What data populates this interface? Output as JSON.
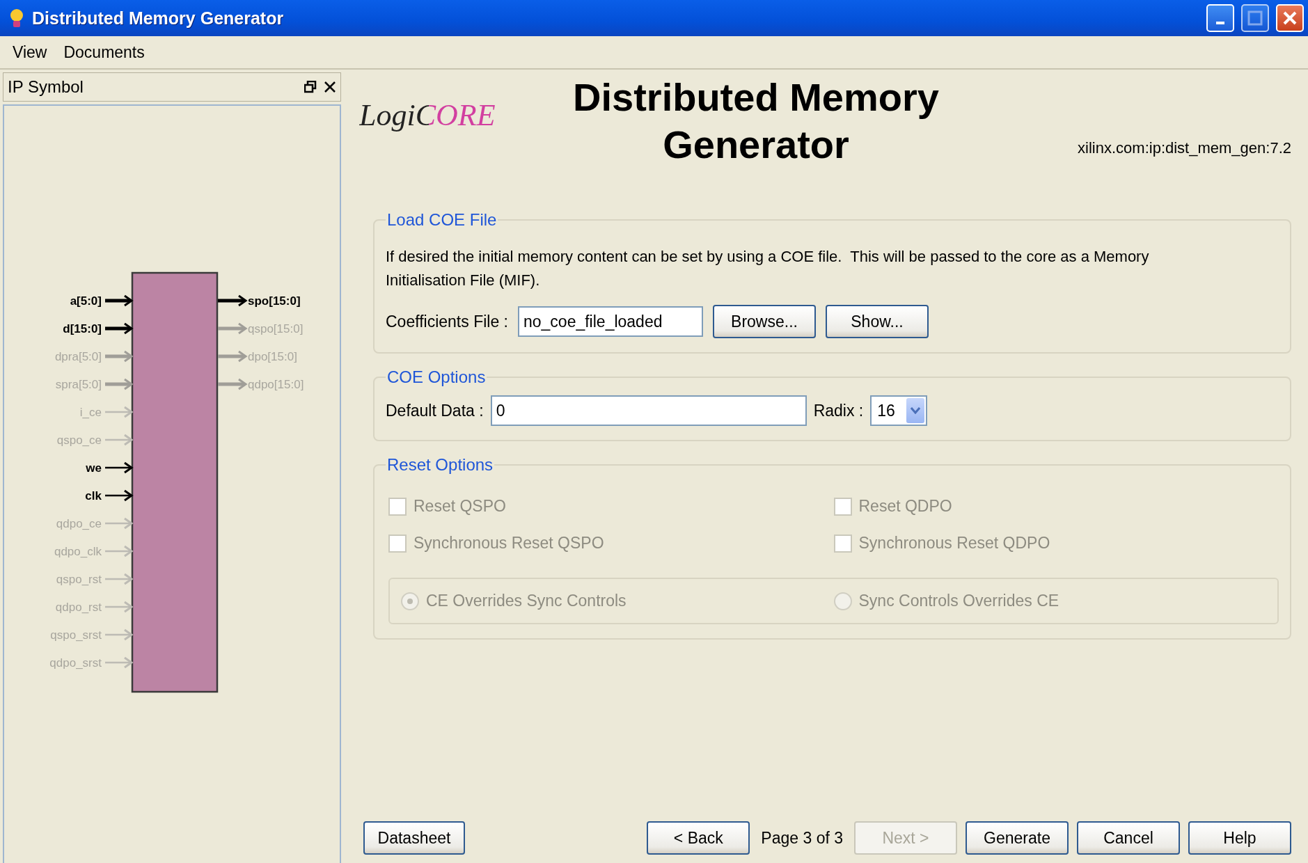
{
  "window": {
    "title": "Distributed Memory Generator"
  },
  "menu": [
    {
      "label": "View"
    },
    {
      "label": "Documents"
    }
  ],
  "ip_symbol": {
    "title": "IP Symbol",
    "inputs": [
      {
        "label": "a[5:0]",
        "active": true,
        "bus": true
      },
      {
        "label": "d[15:0]",
        "active": true,
        "bus": true
      },
      {
        "label": "dpra[5:0]",
        "active": false,
        "bus": true
      },
      {
        "label": "spra[5:0]",
        "active": false,
        "bus": true
      },
      {
        "label": "i_ce",
        "active": false,
        "bus": false
      },
      {
        "label": "qspo_ce",
        "active": false,
        "bus": false
      },
      {
        "label": "we",
        "active": true,
        "bus": false
      },
      {
        "label": "clk",
        "active": true,
        "bus": false
      },
      {
        "label": "qdpo_ce",
        "active": false,
        "bus": false
      },
      {
        "label": "qdpo_clk",
        "active": false,
        "bus": false
      },
      {
        "label": "qspo_rst",
        "active": false,
        "bus": false
      },
      {
        "label": "qdpo_rst",
        "active": false,
        "bus": false
      },
      {
        "label": "qspo_srst",
        "active": false,
        "bus": false
      },
      {
        "label": "qdpo_srst",
        "active": false,
        "bus": false
      }
    ],
    "outputs": [
      {
        "label": "spo[15:0]",
        "active": true,
        "bus": true
      },
      {
        "label": "qspo[15:0]",
        "active": false,
        "bus": true
      },
      {
        "label": "dpo[15:0]",
        "active": false,
        "bus": true
      },
      {
        "label": "qdpo[15:0]",
        "active": false,
        "bus": true
      }
    ]
  },
  "header": {
    "logo": "LogiCORE",
    "title": "Distributed Memory Generator",
    "version": "xilinx.com:ip:dist_mem_gen:7.2"
  },
  "load_coe": {
    "legend": "Load COE File",
    "description": "If desired the initial memory content can be set by using a COE file.  This will be passed to the core as a Memory Initialisation File (MIF).",
    "field_label": "Coefficients File :",
    "value": "no_coe_file_loaded",
    "buttons": [
      {
        "label": "Browse..."
      },
      {
        "label": "Show..."
      }
    ]
  },
  "coe_options": {
    "legend": "COE Options",
    "default_data_label": "Default Data :",
    "default_data": "0",
    "radix_label": "Radix :",
    "radix": "16"
  },
  "reset_options": {
    "legend": "Reset Options",
    "checkboxes": [
      {
        "label": "Reset QSPO",
        "checked": false,
        "disabled": true
      },
      {
        "label": "Reset QDPO",
        "checked": false,
        "disabled": true
      },
      {
        "label": "Synchronous Reset QSPO",
        "checked": false,
        "disabled": true
      },
      {
        "label": "Synchronous Reset QDPO",
        "checked": false,
        "disabled": true
      }
    ],
    "radios": [
      {
        "label": "CE Overrides Sync Controls",
        "selected": true,
        "disabled": true
      },
      {
        "label": "Sync Controls Overrides CE",
        "selected": false,
        "disabled": true
      }
    ]
  },
  "footer": {
    "datasheet": "Datasheet",
    "back": "< Back",
    "page": "Page 3 of 3",
    "next": {
      "label": "Next >",
      "disabled": true
    },
    "buttons": [
      {
        "label": "Generate"
      },
      {
        "label": "Cancel"
      },
      {
        "label": "Help"
      }
    ]
  }
}
